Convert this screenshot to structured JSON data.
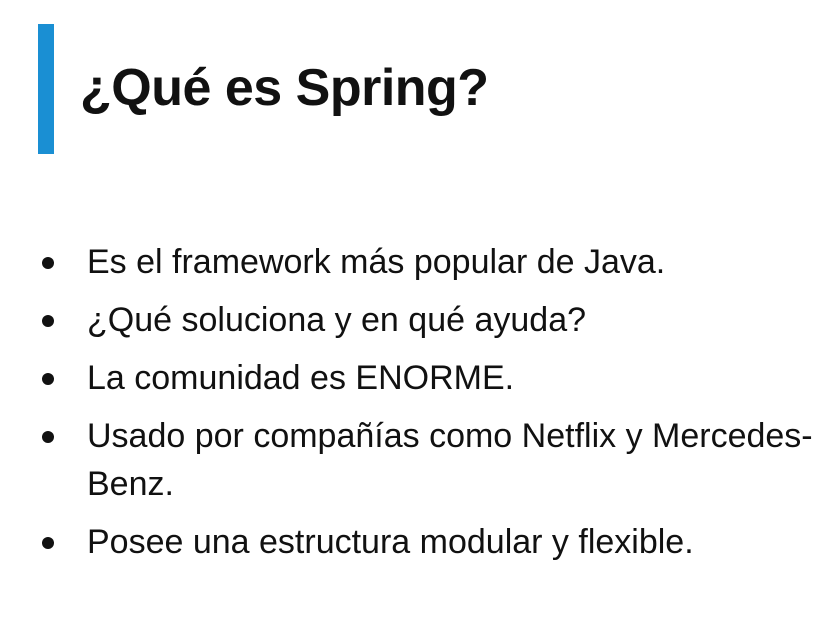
{
  "slide": {
    "title": "¿Qué es Spring?",
    "accent_color": "#1a8fd3",
    "bullets": [
      "Es el framework más popular de Java.",
      "¿Qué soluciona y en qué ayuda?",
      "La comunidad es ENORME.",
      "Usado por compañías como Netflix y Mercedes-Benz.",
      "Posee una estructura modular y flexible."
    ]
  }
}
